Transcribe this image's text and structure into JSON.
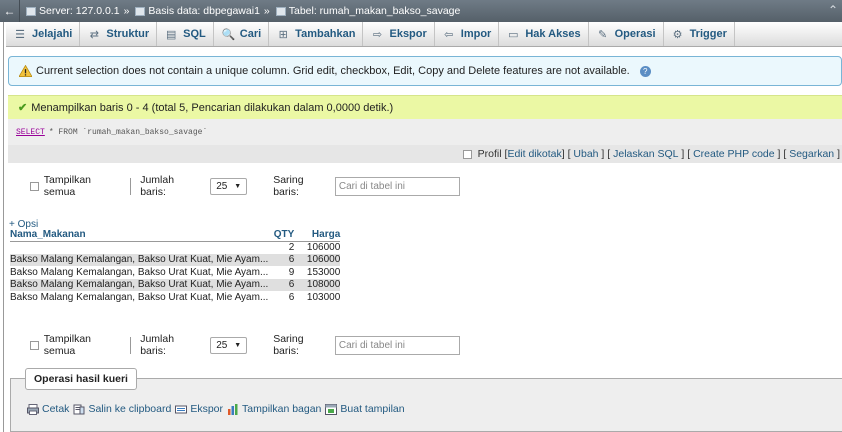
{
  "breadcrumb": {
    "back": "←",
    "server": "Server: 127.0.0.1",
    "database": "Basis data: dbpegawai1",
    "table": "Tabel: rumah_makan_bakso_savage",
    "separator": "»",
    "collapse": "⌃"
  },
  "tabs": [
    {
      "label": "Jelajahi",
      "icon": "☰"
    },
    {
      "label": "Struktur",
      "icon": "⇄"
    },
    {
      "label": "SQL",
      "icon": "▤"
    },
    {
      "label": "Cari",
      "icon": "🔍"
    },
    {
      "label": "Tambahkan",
      "icon": "⊞"
    },
    {
      "label": "Ekspor",
      "icon": "⇨"
    },
    {
      "label": "Impor",
      "icon": "⇦"
    },
    {
      "label": "Hak Akses",
      "icon": "▭"
    },
    {
      "label": "Operasi",
      "icon": "✎"
    },
    {
      "label": "Trigger",
      "icon": "⚙"
    }
  ],
  "notice": {
    "text": "Current selection does not contain a unique column. Grid edit, checkbox, Edit, Copy and Delete features are not available.",
    "help": "?"
  },
  "success": {
    "text": "Menampilkan baris 0 - 4 (total 5, Pencarian dilakukan dalam 0,0000 detik.)"
  },
  "sql": {
    "keyword": "SELECT",
    "rest": "* FROM `rumah_makan_bakso_savage`"
  },
  "profile": {
    "label": "Profil",
    "links": [
      "Edit dikotak",
      "Ubah",
      "Jelaskan SQL",
      "Create PHP code",
      "Segarkan"
    ]
  },
  "nav": {
    "show_all": "Tampilkan semua",
    "rows_label": "Jumlah baris:",
    "rows_value": "25",
    "filter_label": "Saring baris:",
    "filter_placeholder": "Cari di tabel ini"
  },
  "options_link": "+ Opsi",
  "table": {
    "columns": [
      "Nama_Makanan",
      "QTY",
      "Harga"
    ],
    "rows": [
      [
        "",
        "2",
        "106000"
      ],
      [
        "Bakso Malang Kemalangan, Bakso Urat Kuat, Mie Ayam...",
        "6",
        "106000"
      ],
      [
        "Bakso Malang Kemalangan, Bakso Urat Kuat, Mie Ayam...",
        "9",
        "153000"
      ],
      [
        "Bakso Malang Kemalangan, Bakso Urat Kuat, Mie Ayam...",
        "6",
        "108000"
      ],
      [
        "Bakso Malang Kemalangan, Bakso Urat Kuat, Mie Ayam...",
        "6",
        "103000"
      ]
    ]
  },
  "query_ops": {
    "legend": "Operasi hasil kueri",
    "links": [
      "Cetak",
      "Salin ke clipboard",
      "Ekspor",
      "Tampilkan bagan",
      "Buat tampilan"
    ]
  }
}
